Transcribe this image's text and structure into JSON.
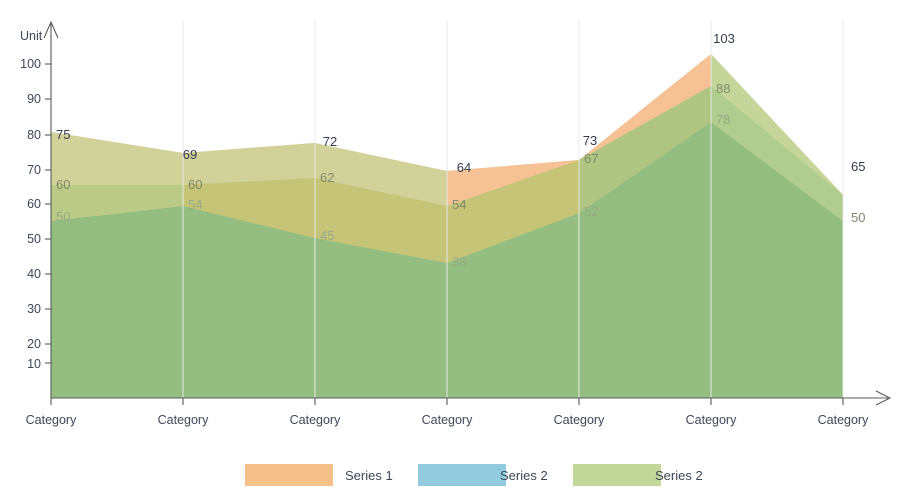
{
  "chart_data": {
    "type": "area",
    "title": "",
    "subtitle": "",
    "xlabel": "",
    "ylabel": "Unit",
    "ylim": [
      0,
      105
    ],
    "yticks": [
      10,
      20,
      30,
      40,
      50,
      60,
      70,
      80,
      90,
      100
    ],
    "grid": "vertical-only",
    "legend_position": "bottom-center",
    "stacked": false,
    "categories": [
      "Category",
      "Category",
      "Category",
      "Category",
      "Category",
      "Category",
      "Category"
    ],
    "series": [
      {
        "name": "Series 1",
        "color": "#f5c08a",
        "values": [
          75,
          69,
          72,
          64,
          73,
          103,
          65
        ]
      },
      {
        "name": "Series 2",
        "color": "#92cbdf",
        "values": [
          60,
          60,
          62,
          54,
          67,
          88,
          65
        ]
      },
      {
        "name": "Series 2",
        "color": "#c4d79b",
        "values": [
          50,
          54,
          45,
          38,
          52,
          78,
          50
        ]
      }
    ],
    "data_labels": {
      "series_1": [
        "75",
        "69",
        "72",
        "64",
        "73",
        "103",
        "65"
      ],
      "series_2_blue": [
        "60",
        "60",
        "62",
        "54",
        "67",
        "88",
        "50"
      ],
      "series_2_green": [
        "50",
        "54",
        "45",
        "38",
        "52",
        "78",
        "65"
      ]
    }
  },
  "axis": {
    "y_title": "Unit",
    "y_tick_labels": [
      "100",
      "90",
      "80",
      "70",
      "60",
      "50",
      "40",
      "30",
      "20",
      "10"
    ],
    "x_tick_labels": [
      "Category",
      "Category",
      "Category",
      "Category",
      "Category",
      "Category",
      "Category"
    ]
  },
  "labels": {
    "top": [
      "75",
      "69",
      "72",
      "64",
      "73",
      "103",
      "65"
    ],
    "mid": [
      "60",
      "60",
      "62",
      "54",
      "67",
      "88",
      "50"
    ],
    "base": [
      "50",
      "54",
      "45",
      "38",
      "52",
      "78",
      "65"
    ]
  },
  "legend": {
    "items": [
      {
        "label": "Series 1",
        "color": "#f5c08a"
      },
      {
        "label": "Series 2",
        "color": "#92cbdf"
      },
      {
        "label": "Series 2",
        "color": "#c4d79b"
      }
    ]
  },
  "colors": {
    "orange": "#f5c08a",
    "blue": "#92cbdf",
    "green": "#c4d79b",
    "blend_blue_green": "#93bd81",
    "blend_orange_green": "#c6c274",
    "axis": "#5a5a5a",
    "text": "#3c4858"
  }
}
